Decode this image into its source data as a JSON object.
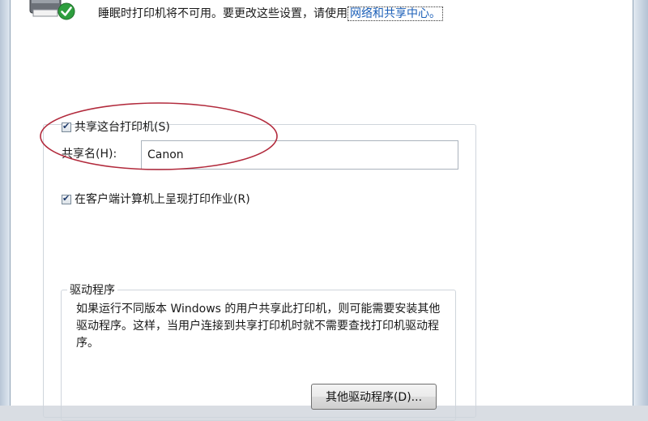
{
  "status": {
    "info_text": "睡眠时打印机将不可用。要更改这些设置，请使用",
    "network_link": "网络和共享中心。"
  },
  "sharing": {
    "share_checkbox_label": "共享这台打印机(S)",
    "share_checked": true,
    "share_name_label": "共享名(H):",
    "share_name_value": "Canon",
    "render_checkbox_label": "在客户端计算机上呈现打印作业(R)",
    "render_checked": true
  },
  "drivers": {
    "title": "驱动程序",
    "description": "如果运行不同版本 Windows 的用户共享此打印机，则可能需要安装其他驱动程序。这样，当用户连接到共享打印机时就不需要查找打印机驱动程序。",
    "button_label": "其他驱动程序(D)..."
  },
  "colors": {
    "link": "#1b5fb8",
    "annotation_ellipse": "#b22a3c",
    "status_check": "#2e9e3e"
  },
  "icons": {
    "printer": "printer-icon",
    "status": "green-check-icon",
    "checkbox": "checkmark-icon"
  }
}
